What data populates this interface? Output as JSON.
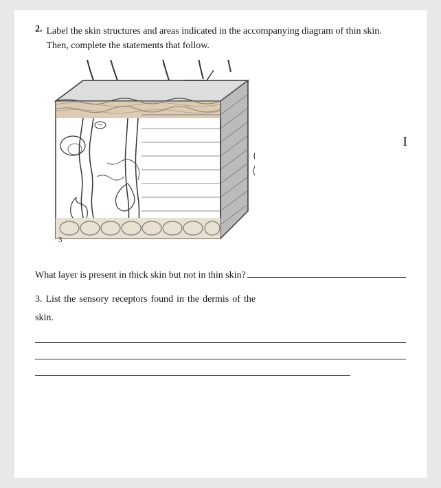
{
  "page": {
    "background": "#ffffff"
  },
  "question2": {
    "number": "2.",
    "text": "Label the skin structures and areas indicated in the accompanying diagram of thin skin. Then, complete the statements that follow."
  },
  "what_layer": {
    "text": "What layer is present in thick skin but not in thin skin?"
  },
  "question3": {
    "number": "3.",
    "label": "List",
    "words": [
      "the",
      "sensory",
      "receptors",
      "found",
      "in",
      "the",
      "dermis",
      "of",
      "the"
    ],
    "last_word": "skin."
  },
  "cursor": {
    "symbol": "I"
  }
}
